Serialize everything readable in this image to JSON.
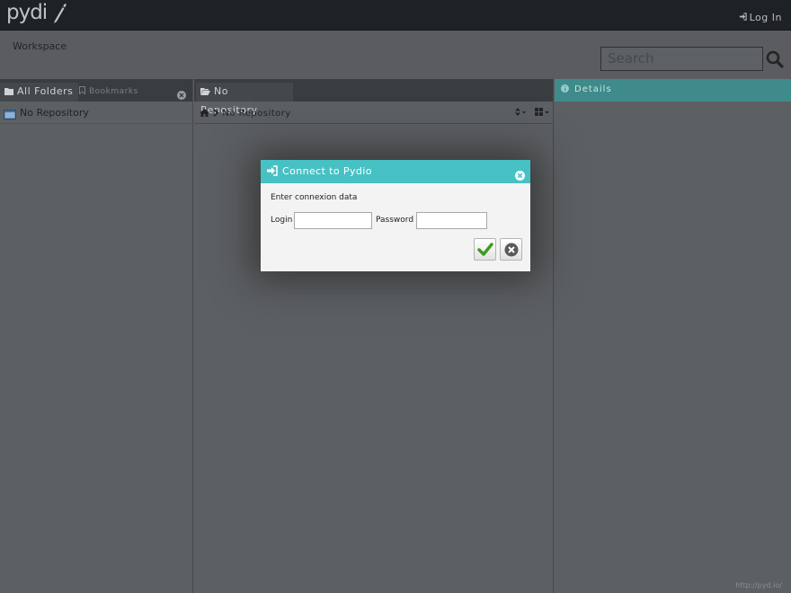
{
  "app": {
    "logo_text": "pydi",
    "login_label": "Log In",
    "workspace_label": "Workspace",
    "footer_link": "http://pyd.io/"
  },
  "search": {
    "placeholder": "Search"
  },
  "left_panel": {
    "tab_active": "All Folders",
    "tab_inactive": "Bookmarks",
    "tree_item": "No Repository"
  },
  "mid_panel": {
    "tab": "No Repository",
    "breadcrumb": "No Repository"
  },
  "right_panel": {
    "tab": "Details",
    "accent_color": "#3f8b8b"
  },
  "modal": {
    "title": "Connect to Pydio",
    "message": "Enter connexion data",
    "login_label": "Login",
    "password_label": "Password",
    "login_value": "",
    "password_value": "",
    "header_color": "#47c1c4"
  },
  "icons": {
    "login": "sign-in-icon",
    "search": "search-icon",
    "folder": "folder-icon",
    "bookmark": "bookmark-icon",
    "close": "close-icon",
    "home": "home-icon",
    "chevron": "chevron-right-icon",
    "sort": "sort-icon",
    "grid": "grid-icon",
    "info": "info-icon",
    "confirm": "checkmark-icon",
    "cancel": "cancel-icon"
  }
}
